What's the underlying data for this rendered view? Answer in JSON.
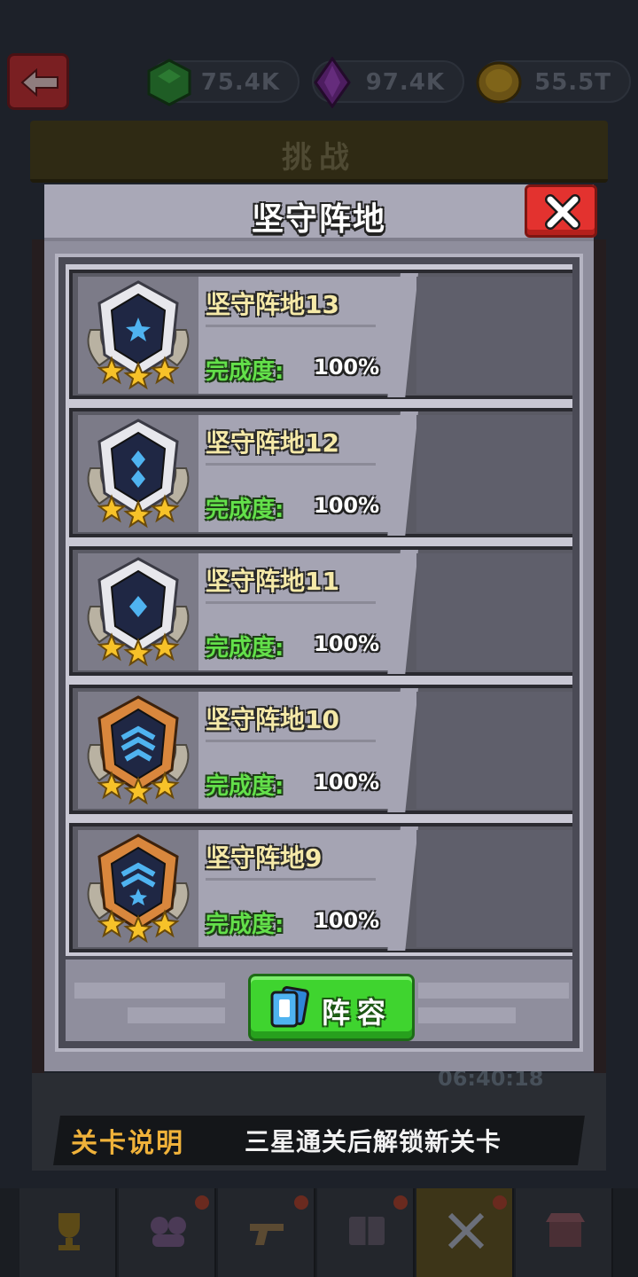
{
  "header": {
    "back_icon": "back-arrow-icon",
    "resources": [
      {
        "icon": "green-gem-icon",
        "value": "75.4K",
        "color": "#3bb54a"
      },
      {
        "icon": "purple-crystal-icon",
        "value": "97.4K",
        "color": "#a23fc9"
      },
      {
        "icon": "gold-coin-icon",
        "value": "55.5T",
        "color": "#e0a82a"
      }
    ],
    "page_title": "挑战"
  },
  "modal": {
    "title": "坚守阵地",
    "close_icon": "close-x-icon",
    "levels": [
      {
        "name": "坚守阵地13",
        "progress_label": "完成度:",
        "progress_value": "100%",
        "stars": 3,
        "badge": "silver-star-badge-icon"
      },
      {
        "name": "坚守阵地12",
        "progress_label": "完成度:",
        "progress_value": "100%",
        "stars": 3,
        "badge": "silver-double-diamond-badge-icon"
      },
      {
        "name": "坚守阵地11",
        "progress_label": "完成度:",
        "progress_value": "100%",
        "stars": 3,
        "badge": "silver-diamond-badge-icon"
      },
      {
        "name": "坚守阵地10",
        "progress_label": "完成度:",
        "progress_value": "100%",
        "stars": 3,
        "badge": "bronze-chevron-badge-icon"
      },
      {
        "name": "坚守阵地9",
        "progress_label": "完成度:",
        "progress_value": "100%",
        "stars": 3,
        "badge": "bronze-chevron-star-badge-icon"
      }
    ],
    "lineup_button": {
      "label": "阵容",
      "icon": "cards-icon"
    }
  },
  "background": {
    "timer": "06:40:18",
    "stage_note_label": "关卡说明",
    "stage_note_text": "三星通关后解锁新关卡",
    "nav_tabs": [
      {
        "icon": "trophy-icon"
      },
      {
        "icon": "heroes-icon"
      },
      {
        "icon": "gun-icon"
      },
      {
        "icon": "book-icon"
      },
      {
        "icon": "crossed-swords-icon",
        "active": true
      },
      {
        "icon": "shop-icon"
      }
    ]
  },
  "colors": {
    "accent_green": "#3fd42f",
    "close_red": "#e3322f",
    "progress_green": "#63e04a",
    "name_yellow": "#f5e9a8"
  }
}
